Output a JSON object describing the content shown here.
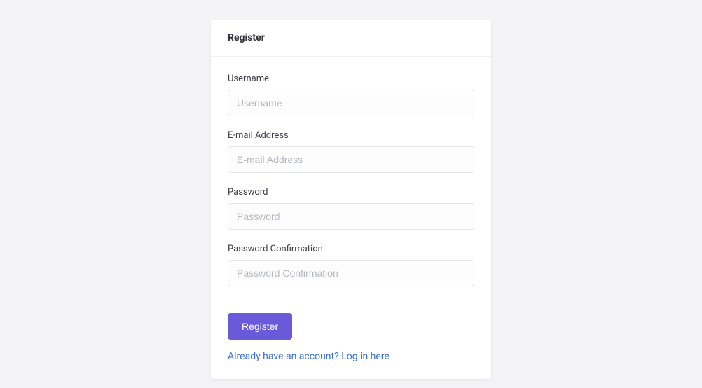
{
  "header": {
    "title": "Register"
  },
  "form": {
    "username": {
      "label": "Username",
      "placeholder": "Username",
      "value": ""
    },
    "email": {
      "label": "E-mail Address",
      "placeholder": "E-mail Address",
      "value": ""
    },
    "password": {
      "label": "Password",
      "placeholder": "Password",
      "value": ""
    },
    "password_confirmation": {
      "label": "Password Confirmation",
      "placeholder": "Password Confirmation",
      "value": ""
    },
    "submit_label": "Register",
    "login_link_text": "Already have an account? Log in here"
  }
}
